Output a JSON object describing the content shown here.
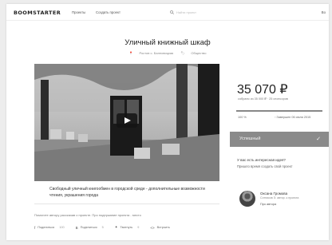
{
  "header": {
    "logo": "BOOMSTARTER",
    "nav": [
      "Проекты",
      "Создать проект"
    ],
    "search_placeholder": "Найти проект",
    "right_link": "Во"
  },
  "project": {
    "title": "Уличный книжный шкаф",
    "location": "Ростов с. Балновицкая",
    "category": "Общество"
  },
  "funding": {
    "amount": "35 070 ₽",
    "collected_text": "собрано из 35 000 ₽ · 25 спонсоров",
    "percent_label": "100 %",
    "progress_fraction": 1.0,
    "deadline": "Завершен 06 июля 2015",
    "status_label": "Успешный",
    "status_icon": "check-icon"
  },
  "idea": {
    "question": "У вас есть интересная идея?",
    "prompt": "Пришло время создать свой проект"
  },
  "description": "Свободный уличный книгообмен в городской среде - дополнительные возможности чтения, украшения города",
  "author": {
    "name": "Оксана Громова",
    "about": "Сотников Э. автор. к проекта",
    "link": "Про автора"
  },
  "help_text": "Помогите автору рассказав о проекте. Про подержание проекта - место",
  "shares": [
    {
      "icon": "facebook-icon",
      "glyph": "f",
      "label": "Поделиться",
      "count": "100"
    },
    {
      "icon": "vk-icon",
      "glyph": "В",
      "label": "Поделиться",
      "count": "5"
    },
    {
      "icon": "twitter-icon",
      "glyph": "✦",
      "label": "Твитнуть",
      "count": "9"
    },
    {
      "icon": "embed-icon",
      "glyph": "<>",
      "label": "Встроить",
      "count": ""
    }
  ],
  "colors": {
    "status_bg": "#8a8a8a",
    "progress": "#888888"
  }
}
